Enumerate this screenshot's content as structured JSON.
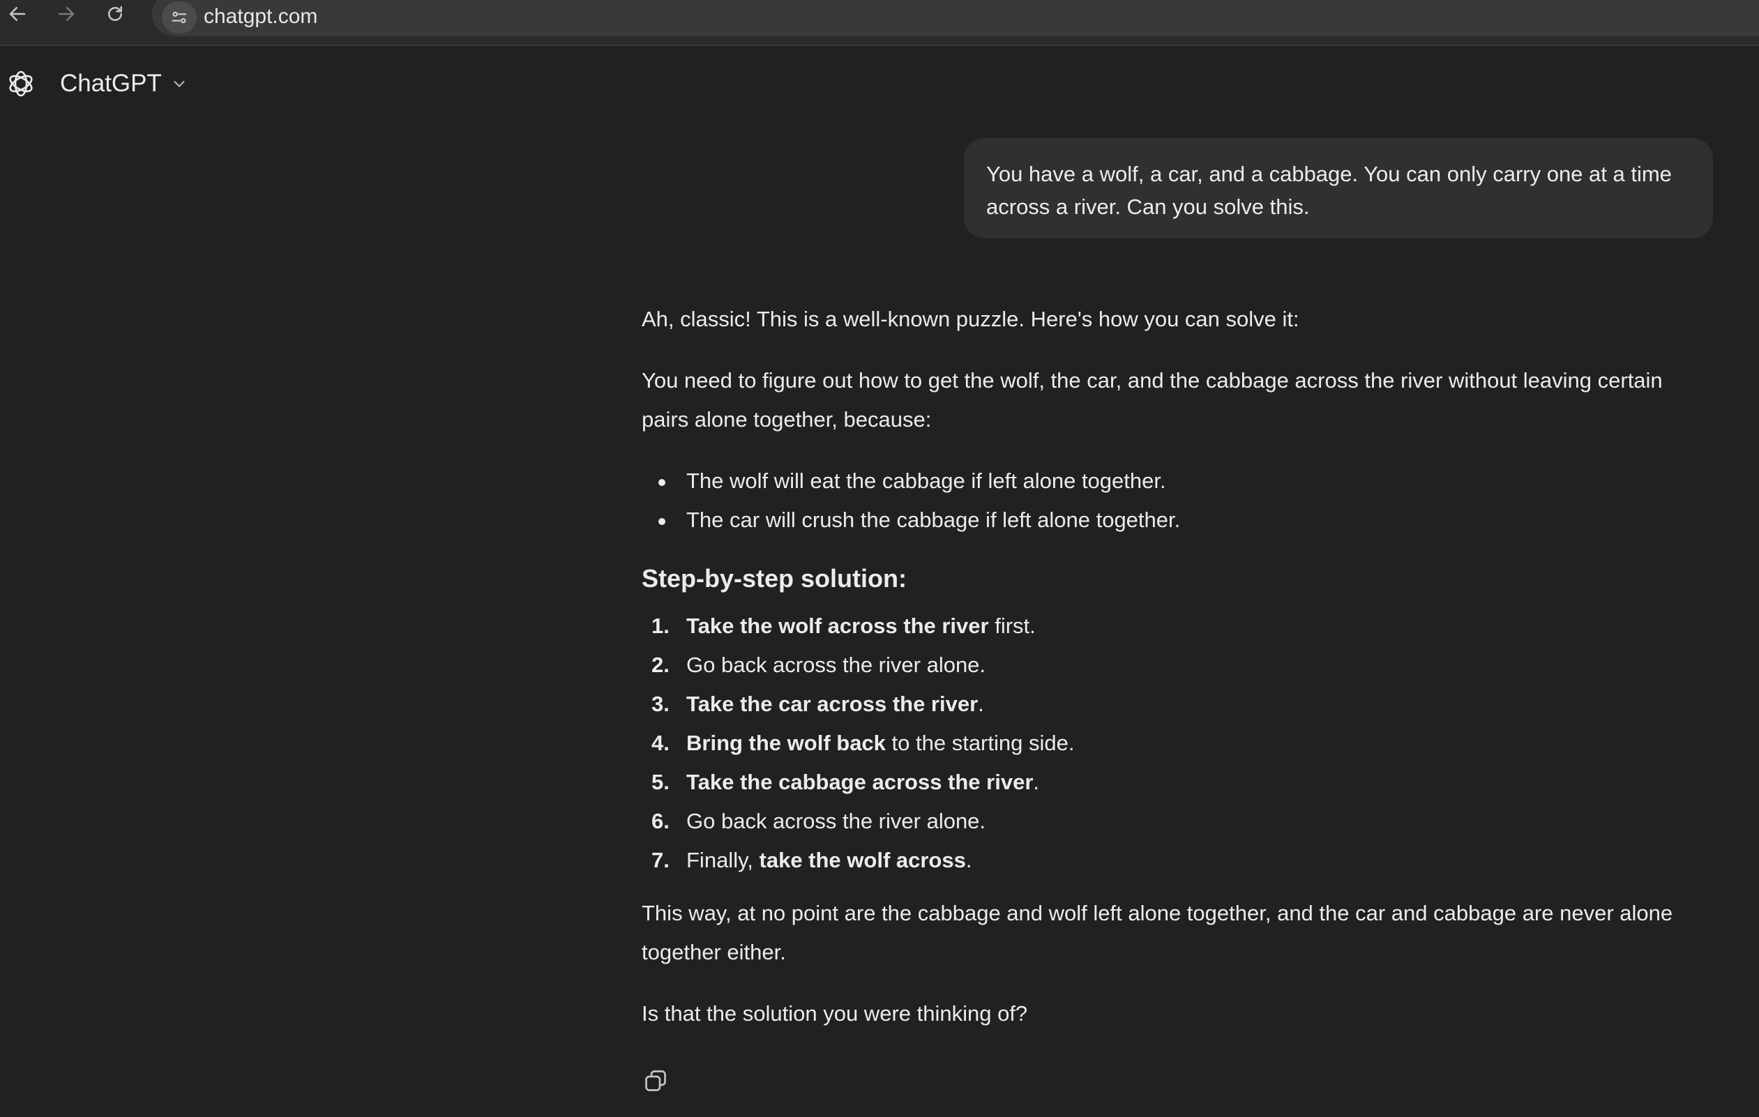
{
  "browser": {
    "url": "chatgpt.com",
    "icons": [
      "back-arrow-icon",
      "forward-arrow-icon",
      "reload-icon",
      "site-info-icon"
    ]
  },
  "header": {
    "model_name": "ChatGPT",
    "icons": [
      "openai-logo-icon",
      "chevron-down-icon"
    ]
  },
  "conversation": {
    "user_message": "You have a wolf, a car, and a cabbage. You can only carry one at a time across a river. Can you solve this.",
    "assistant": {
      "intro": "Ah, classic! This is a well-known puzzle. Here's how you can solve it:",
      "para1": "You need to figure out how to get the wolf, the car, and the cabbage across the river without leaving certain pairs alone together, because:",
      "bullets": [
        "The wolf will eat the cabbage if left alone together.",
        "The car will crush the cabbage if left alone together."
      ],
      "heading": "Step-by-step solution:",
      "steps": [
        {
          "num": "1.",
          "pre": "",
          "bold": "Take the wolf across the river",
          "post": " first."
        },
        {
          "num": "2.",
          "pre": "Go back across the river alone.",
          "bold": "",
          "post": ""
        },
        {
          "num": "3.",
          "pre": "",
          "bold": "Take the car across the river",
          "post": "."
        },
        {
          "num": "4.",
          "pre": "",
          "bold": "Bring the wolf back",
          "post": " to the starting side."
        },
        {
          "num": "5.",
          "pre": "",
          "bold": "Take the cabbage across the river",
          "post": "."
        },
        {
          "num": "6.",
          "pre": "Go back across the river alone.",
          "bold": "",
          "post": ""
        },
        {
          "num": "7.",
          "pre": "Finally, ",
          "bold": "take the wolf across",
          "post": "."
        }
      ],
      "conclusion": "This way, at no point are the cabbage and wolf left alone together, and the car and cabbage are never alone together either.",
      "question": "Is that the solution you were thinking of?",
      "actions": [
        "copy-icon"
      ]
    }
  },
  "colors": {
    "background": "#212121",
    "browser_bar": "#2b2b2c",
    "url_pill": "#393939",
    "user_bubble": "#303030",
    "text": "#ececec"
  }
}
